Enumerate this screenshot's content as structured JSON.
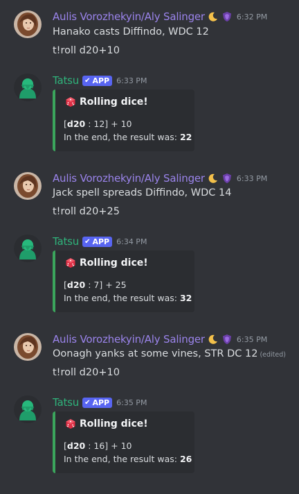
{
  "colors": {
    "background": "#313338",
    "user_name_color": "#9b84ec",
    "bot_name_color": "#2fb37b",
    "app_badge": "#5865f2",
    "embed_bar": "#3ba55c",
    "embed_bg": "#2b2d31",
    "timestamp": "#949ba4"
  },
  "messages": [
    {
      "author": "Aulis Vorozhekyin/Aly Salinger",
      "timestamp": "6:32 PM",
      "lines": [
        "Hanako casts Diffindo, WDC 12",
        "t!roll d20+10"
      ],
      "icons": [
        "crescent-moon",
        "purple-role-shield"
      ]
    },
    {
      "author": "Tatsu",
      "badge": "APP",
      "timestamp": "6:33 PM",
      "embed": {
        "title": "Rolling dice!",
        "roll_die": "d20",
        "roll_rest": " : 12] + 10",
        "result_prefix": "In the end, the result was: ",
        "result": "22"
      }
    },
    {
      "author": "Aulis Vorozhekyin/Aly Salinger",
      "timestamp": "6:33 PM",
      "lines": [
        "Jack spell spreads Diffindo, WDC 14",
        "t!roll d20+25"
      ],
      "icons": [
        "crescent-moon",
        "purple-role-shield"
      ]
    },
    {
      "author": "Tatsu",
      "badge": "APP",
      "timestamp": "6:34 PM",
      "embed": {
        "title": "Rolling dice!",
        "roll_die": "d20",
        "roll_rest": " : 7] + 25",
        "result_prefix": "In the end, the result was: ",
        "result": "32"
      }
    },
    {
      "author": "Aulis Vorozhekyin/Aly Salinger",
      "timestamp": "6:35 PM",
      "lines": [
        "Oonagh yanks at some vines, STR DC 12",
        "t!roll d20+10"
      ],
      "edited": "(edited)",
      "icons": [
        "crescent-moon",
        "purple-role-shield"
      ]
    },
    {
      "author": "Tatsu",
      "badge": "APP",
      "timestamp": "6:35 PM",
      "embed": {
        "title": "Rolling dice!",
        "roll_die": "d20",
        "roll_rest": " : 16] + 10",
        "result_prefix": "In the end, the result was: ",
        "result": "26"
      }
    }
  ]
}
